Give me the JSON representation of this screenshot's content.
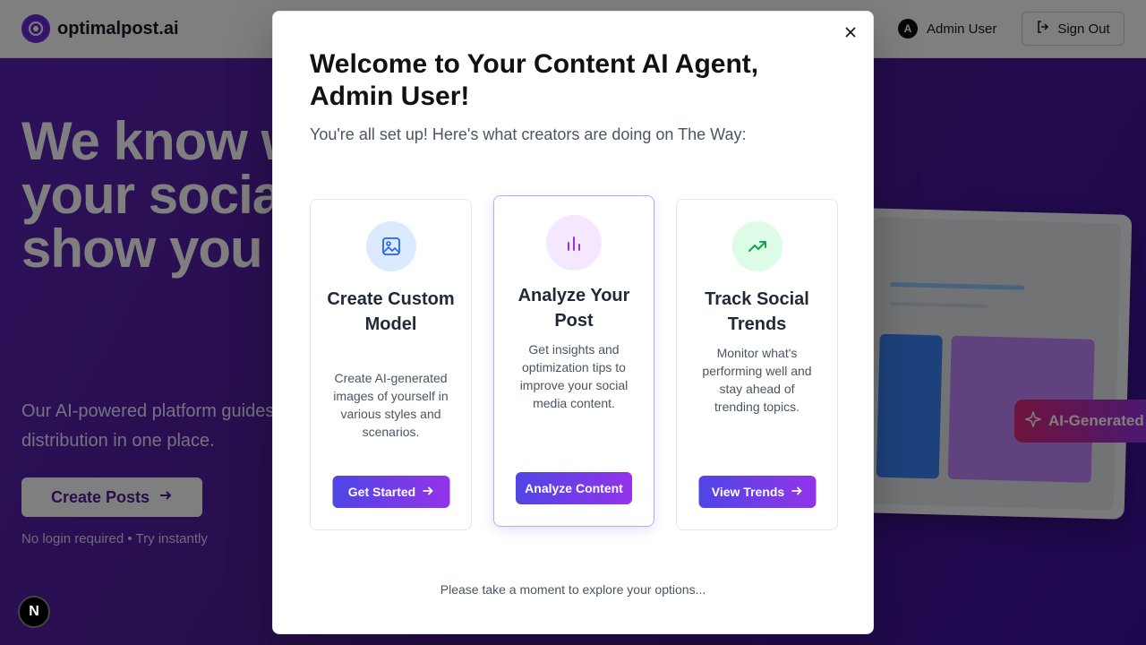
{
  "nav": {
    "logo_text": "optimalpost.ai",
    "user_initial": "A",
    "user_name": "Admin User",
    "signout_label": "Sign Out"
  },
  "hero": {
    "title": "We know what's best for your social media. We show you done.",
    "subtitle": "Our AI-powered platform guides your content creation, targeting, and distribution in one place.",
    "cta_label": "Create Posts",
    "note": "No login required • Try instantly",
    "badge_label": "AI-Generated"
  },
  "next_badge": "N",
  "modal": {
    "close_symbol": "×",
    "title": "Welcome to Your Content AI Agent, Admin User!",
    "subtitle": "You're all set up! Here's what creators are doing on The Way:",
    "footer": "Please take a moment to explore your options...",
    "cards": [
      {
        "icon": "image-icon",
        "title": "Create Custom Model",
        "description": "Create AI-generated images of yourself in various styles and scenarios.",
        "button": "Get Started"
      },
      {
        "icon": "bar-chart-icon",
        "title": "Analyze Your Post",
        "description": "Get insights and optimization tips to improve your social media content.",
        "button": "Analyze Content"
      },
      {
        "icon": "trending-up-icon",
        "title": "Track Social Trends",
        "description": "Monitor what's performing well and stay ahead of trending topics.",
        "button": "View Trends"
      }
    ]
  },
  "colors": {
    "accent_start": "#4f46e5",
    "accent_end": "#9333ea",
    "hero_bg": "#4c1d95"
  }
}
